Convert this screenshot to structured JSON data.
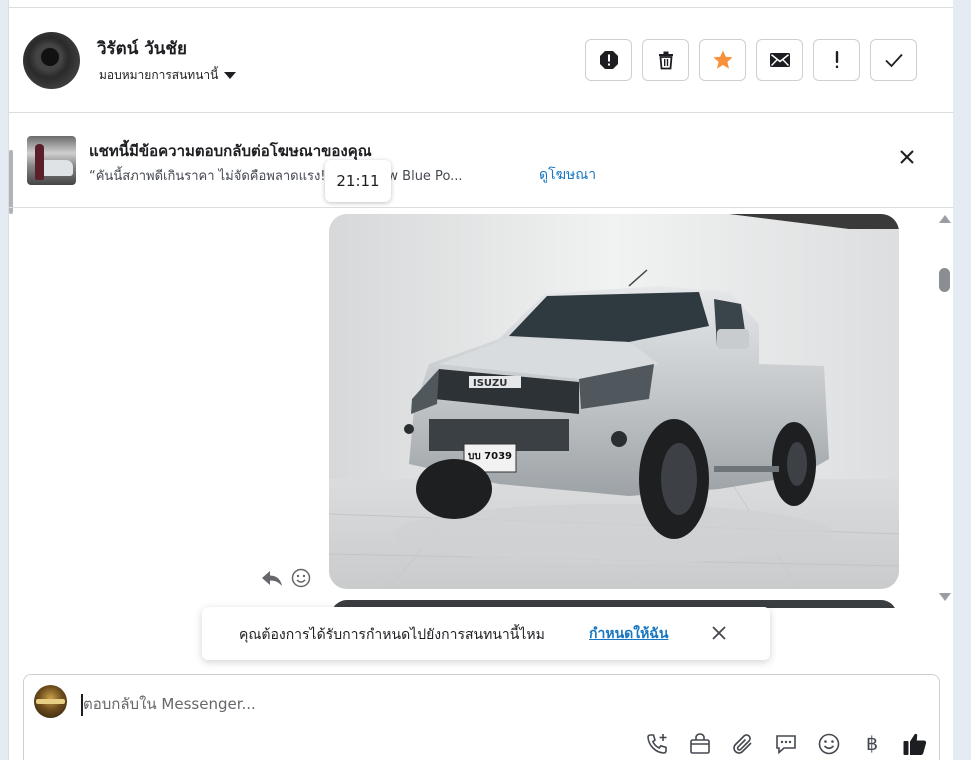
{
  "contact": {
    "name": "วิรัตน์ วันชัย",
    "assign_label": "มอบหมายการสนทนานี้"
  },
  "ad": {
    "title": "แชทนี้มีข้อความตอบกลับต่อโฆษณาของคุณ",
    "snippet": "“คันนี้สภาพดีเกินราคา ไม่จัดคือพลาดแรง!           ax All New Blue Po...",
    "link_label": "ดูโฆษณา"
  },
  "tooltip": {
    "time": "21:11"
  },
  "toast": {
    "text": "คุณต้องการได้รับการกำหนดไปยังการสนทนานี้ไหม",
    "link_label": "กำหนดให้ฉัน"
  },
  "photo": {
    "plate_line1": "บบ 7039",
    "brand": "ISUZU"
  },
  "composer": {
    "placeholder": "ตอบกลับใน Messenger...",
    "currency_symbol": "฿"
  },
  "icons": {
    "header_actions": [
      "spam-icon",
      "trash-icon",
      "star-icon",
      "envelope-icon",
      "exclamation-icon",
      "check-icon"
    ],
    "composer_tools": [
      "call-plus-icon",
      "shopping-bag-icon",
      "paperclip-icon",
      "chat-bubble-icon",
      "emoji-icon",
      "baht-icon",
      "thumbs-up-icon"
    ]
  },
  "colors": {
    "star": "#f7923a",
    "link": "#1877c0",
    "accent_blue": "#1877c0",
    "divider": "#dadde1"
  }
}
